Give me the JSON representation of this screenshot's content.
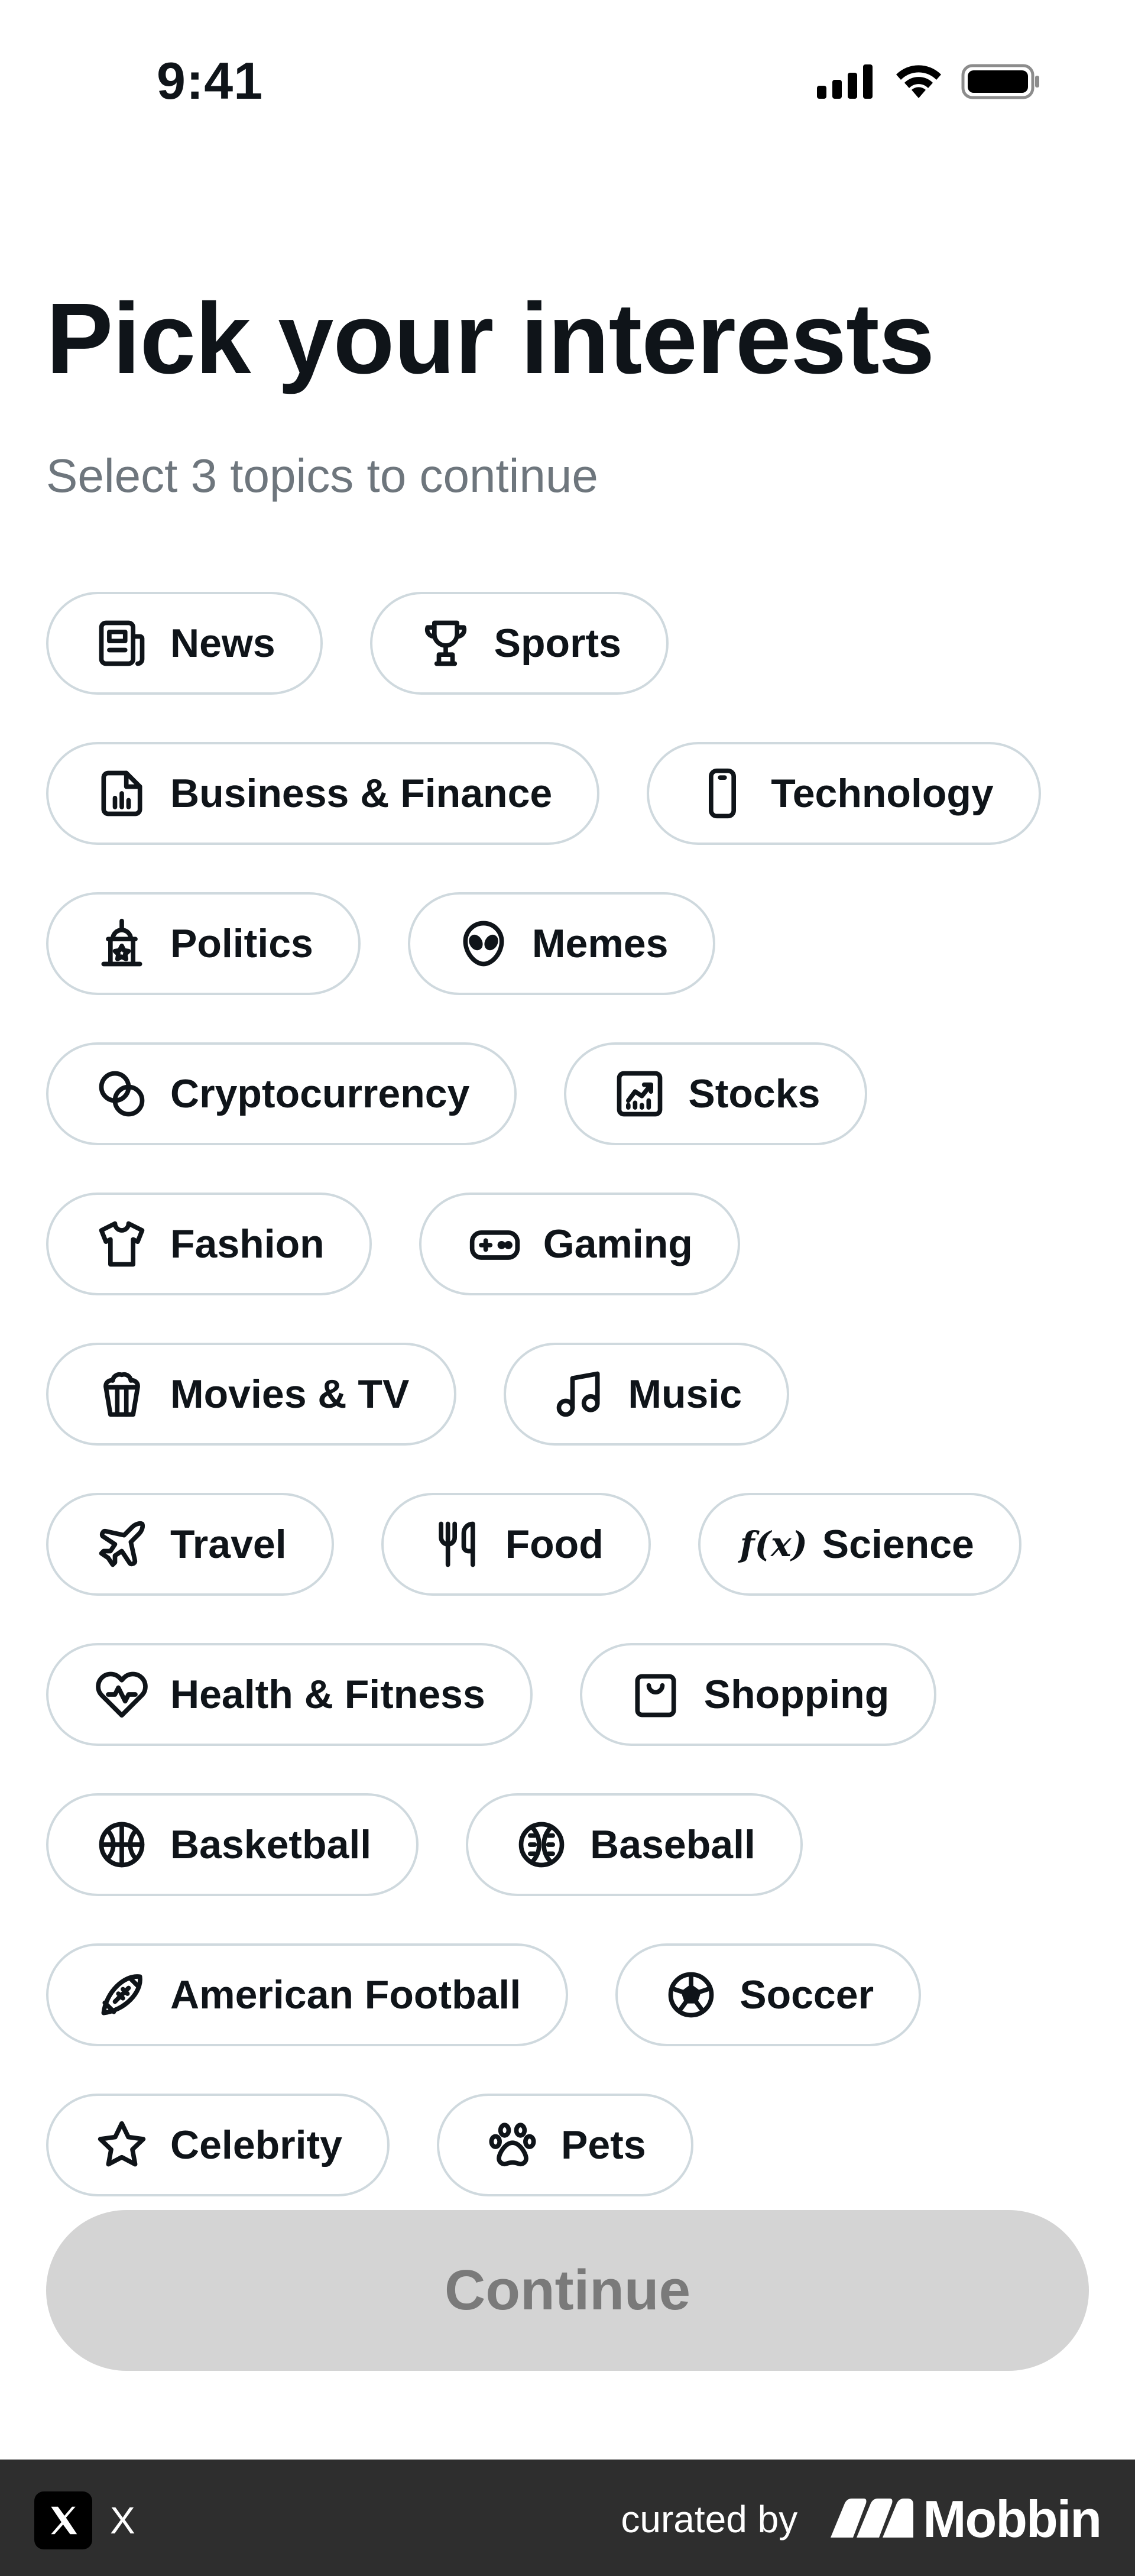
{
  "status_bar": {
    "time": "9:41",
    "icons": [
      "cellular-signal-icon",
      "wifi-icon",
      "battery-icon"
    ]
  },
  "header": {
    "title": "Pick your interests",
    "subtitle": "Select 3 topics to continue"
  },
  "topics": [
    {
      "label": "News",
      "icon": "newspaper-icon"
    },
    {
      "label": "Sports",
      "icon": "trophy-icon"
    },
    {
      "label": "Business & Finance",
      "icon": "bar-chart-document-icon"
    },
    {
      "label": "Technology",
      "icon": "smartphone-icon"
    },
    {
      "label": "Politics",
      "icon": "capitol-building-icon"
    },
    {
      "label": "Memes",
      "icon": "alien-face-icon"
    },
    {
      "label": "Cryptocurrency",
      "icon": "coins-icon"
    },
    {
      "label": "Stocks",
      "icon": "trending-chart-icon"
    },
    {
      "label": "Fashion",
      "icon": "tshirt-icon"
    },
    {
      "label": "Gaming",
      "icon": "gamepad-icon"
    },
    {
      "label": "Movies & TV",
      "icon": "popcorn-icon"
    },
    {
      "label": "Music",
      "icon": "music-note-icon"
    },
    {
      "label": "Travel",
      "icon": "airplane-icon"
    },
    {
      "label": "Food",
      "icon": "fork-knife-icon"
    },
    {
      "label": "Science",
      "icon": "function-icon",
      "icon_text": "f(x)"
    },
    {
      "label": "Health & Fitness",
      "icon": "heart-pulse-icon"
    },
    {
      "label": "Shopping",
      "icon": "shopping-bag-icon"
    },
    {
      "label": "Basketball",
      "icon": "basketball-icon"
    },
    {
      "label": "Baseball",
      "icon": "baseball-icon"
    },
    {
      "label": "American Football",
      "icon": "american-football-icon"
    },
    {
      "label": "Soccer",
      "icon": "soccer-ball-icon"
    },
    {
      "label": "Celebrity",
      "icon": "star-icon"
    },
    {
      "label": "Pets",
      "icon": "paw-print-icon"
    }
  ],
  "continue_button": {
    "label": "Continue",
    "enabled": false,
    "background": "#d4d4d4",
    "text_color": "#7a7a7a"
  },
  "footer": {
    "app_name": "X",
    "curated_by": "curated by",
    "brand": "Mobbin",
    "background": "#2e2e2e"
  },
  "colors": {
    "text": "#0f1419",
    "subtitle": "#6e767d",
    "chip_border": "#cfd9de"
  }
}
